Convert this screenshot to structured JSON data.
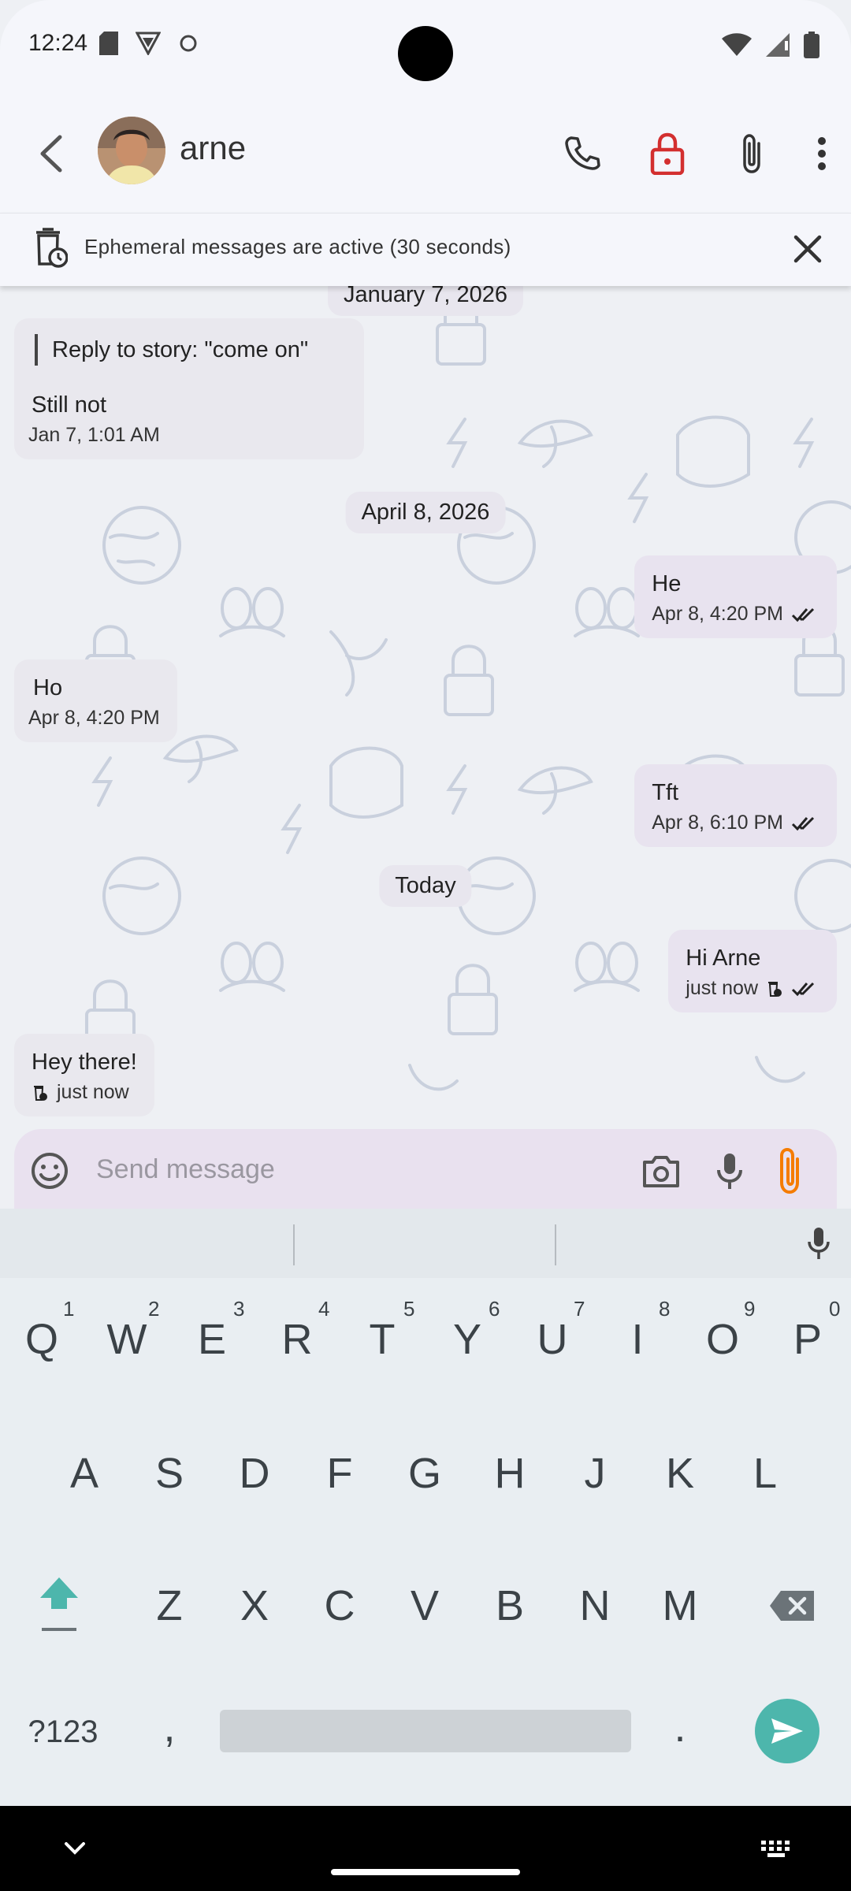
{
  "status_bar": {
    "time": "12:24"
  },
  "header": {
    "contact_name": "arne",
    "icons": [
      "back-arrow-icon",
      "call-icon",
      "lock-open-icon",
      "attachment-icon",
      "more-vert-icon"
    ],
    "lock_color": "#d32f2f"
  },
  "banner": {
    "text": "Ephemeral messages are active (30 seconds)"
  },
  "chat": {
    "partial_date": "January 7, 2026",
    "msg1": {
      "quote": "Reply to story: \"come on\"",
      "text": "Still not",
      "time": "Jan 7, 1:01 AM"
    },
    "date2": "April 8, 2026",
    "msg2": {
      "text": "He",
      "time": "Apr 8, 4:20 PM"
    },
    "msg3": {
      "text": "Ho",
      "time": "Apr 8, 4:20 PM"
    },
    "msg4": {
      "text": "Tft",
      "time": "Apr 8, 6:10 PM"
    },
    "date3": "Today",
    "msg5": {
      "text": "Hi Arne",
      "time": "just now"
    },
    "msg6": {
      "text": "Hey there!",
      "time": "just now"
    }
  },
  "composer": {
    "placeholder": "Send message",
    "accent": "#f57c00"
  },
  "keyboard": {
    "row1": [
      "Q",
      "W",
      "E",
      "R",
      "T",
      "Y",
      "U",
      "I",
      "O",
      "P"
    ],
    "row1_nums": [
      "1",
      "2",
      "3",
      "4",
      "5",
      "6",
      "7",
      "8",
      "9",
      "0"
    ],
    "row2": [
      "A",
      "S",
      "D",
      "F",
      "G",
      "H",
      "J",
      "K",
      "L"
    ],
    "row3": [
      "Z",
      "X",
      "C",
      "V",
      "B",
      "N",
      "M"
    ],
    "symbols_key": "?123",
    "comma": ",",
    "period": ".",
    "accent": "#4db6ac"
  }
}
